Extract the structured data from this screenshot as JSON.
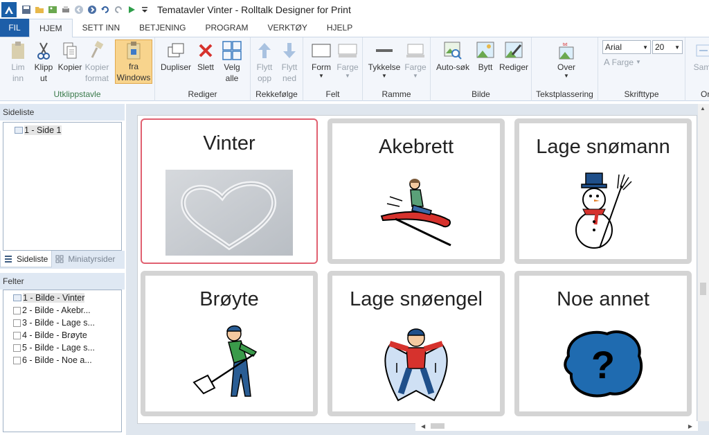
{
  "window": {
    "title": "Tematavler Vinter - Rolltalk Designer for Print"
  },
  "menu": {
    "file": "FIL",
    "tabs": [
      "HJEM",
      "SETT INN",
      "BETJENING",
      "PROGRAM",
      "VERKTØY",
      "HJELP"
    ]
  },
  "ribbon": {
    "clipboard": {
      "label": "Utklippstavle",
      "paste": [
        "Lim",
        "inn"
      ],
      "cut": [
        "Klipp",
        "ut"
      ],
      "copy": "Kopier",
      "copy_format": [
        "Kopier",
        "format"
      ],
      "from_windows": [
        "fra",
        "Windows"
      ]
    },
    "edit": {
      "label": "Rediger",
      "duplicate": "Dupliser",
      "delete": "Slett",
      "select_all": [
        "Velg",
        "alle"
      ]
    },
    "order": {
      "label": "Rekkefølge",
      "move_up": [
        "Flytt",
        "opp"
      ],
      "move_down": [
        "Flytt",
        "ned"
      ]
    },
    "field": {
      "label": "Felt",
      "shape": "Form",
      "color": "Farge"
    },
    "frame": {
      "label": "Ramme",
      "thickness": "Tykkelse",
      "color": "Farge"
    },
    "image": {
      "label": "Bilde",
      "auto_search": "Auto-søk",
      "replace": "Bytt",
      "edit": "Rediger"
    },
    "text_placement": {
      "label": "Tekstplassering",
      "over": "Over"
    },
    "font": {
      "label": "Skrifttype",
      "family": "Arial",
      "size": "20",
      "color": "Farge"
    },
    "more": {
      "partial_button": "Samr",
      "partial_label": "Or"
    }
  },
  "pages_panel": {
    "title": "Sideliste",
    "items": [
      "1 - Side 1"
    ],
    "tab_pages": "Sideliste",
    "tab_thumbnails": "Miniatyrsider"
  },
  "fields_panel": {
    "title": "Felter",
    "items": [
      "1 - Bilde - Vinter",
      "2 - Bilde - Akebr...",
      "3 - Bilde - Lage s...",
      "4 - Bilde - Brøyte",
      "5 - Bilde - Lage s...",
      "6 - Bilde - Noe a..."
    ]
  },
  "board": {
    "cells": [
      {
        "label": "Vinter",
        "image": "snow-heart-photo"
      },
      {
        "label": "Akebrett",
        "image": "sledding-person-icon"
      },
      {
        "label": "Lage snømann",
        "image": "snowman-icon"
      },
      {
        "label": "Brøyte",
        "image": "shoveling-person-icon"
      },
      {
        "label": "Lage snøengel",
        "image": "snow-angel-icon"
      },
      {
        "label": "Noe annet",
        "image": "question-mark-icon"
      }
    ]
  },
  "colors": {
    "accent": "#1d5ea8",
    "selected_cell_border": "#e06070",
    "cell_border": "#d4d4d4",
    "ribbon_bg": "#f3f6fb"
  }
}
